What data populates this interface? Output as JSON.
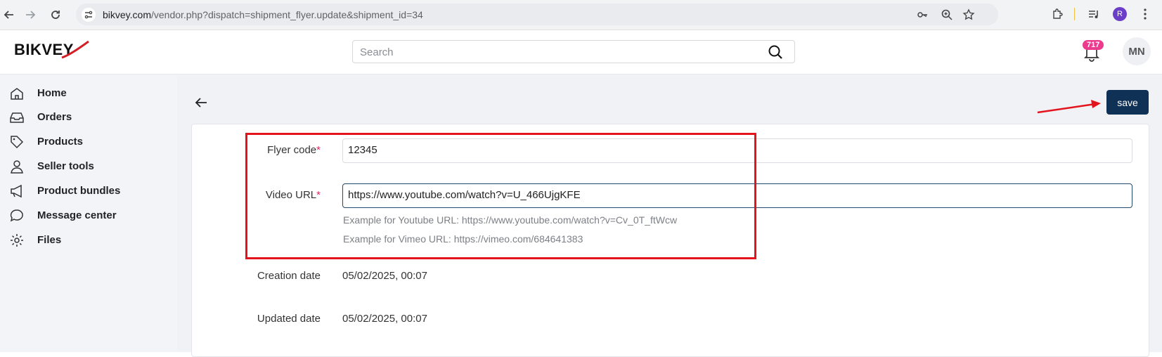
{
  "browser": {
    "url_host": "bikvey.com",
    "url_rest": "/vendor.php?dispatch=shipment_flyer.update&shipment_id=34",
    "profile_initial": "R"
  },
  "header": {
    "logo_text": "BIKVEY",
    "search_placeholder": "Search",
    "notification_count": "717",
    "avatar_initials": "MN"
  },
  "sidebar": {
    "items": [
      {
        "label": "Home",
        "icon": "home-icon"
      },
      {
        "label": "Orders",
        "icon": "inbox-icon"
      },
      {
        "label": "Products",
        "icon": "tag-icon"
      },
      {
        "label": "Seller tools",
        "icon": "user-icon"
      },
      {
        "label": "Product bundles",
        "icon": "megaphone-icon"
      },
      {
        "label": "Message center",
        "icon": "chat-bubble-icon"
      },
      {
        "label": "Files",
        "icon": "gear-icon"
      }
    ]
  },
  "toolbar": {
    "save_label": "save"
  },
  "form": {
    "flyer_code_label": "Flyer code",
    "flyer_code_value": "12345",
    "video_url_label": "Video URL",
    "video_url_value": "https://www.youtube.com/watch?v=U_466UjgKFE",
    "hint_youtube": "Example for Youtube URL: https://www.youtube.com/watch?v=Cv_0T_ftWcw",
    "hint_vimeo": "Example for Vimeo URL: https://vimeo.com/684641383",
    "required_mark": "*",
    "creation_date_label": "Creation date",
    "creation_date_value": "05/02/2025, 00:07",
    "updated_date_label": "Updated date",
    "updated_date_value": "05/02/2025, 00:07"
  },
  "colors": {
    "accent": "#0f3156",
    "annotation_red": "#e4141c",
    "badge_pink": "#ec3a8f"
  }
}
